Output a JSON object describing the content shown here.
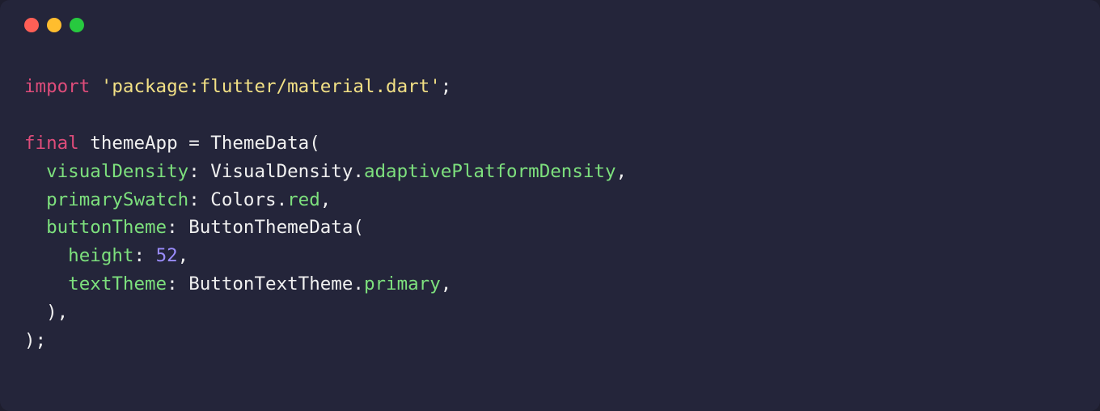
{
  "lights": {
    "red": "red",
    "yellow": "yellow",
    "green": "green"
  },
  "code": {
    "l1_import": "import",
    "l1_string": "'package:flutter/material.dart'",
    "l1_semi": ";",
    "l2_final": "final",
    "l2_name": " themeApp ",
    "l2_eq": "= ",
    "l2_call": "ThemeData(",
    "l3_param": "  visualDensity",
    "l3_colon": ": ",
    "l3_val1": "VisualDensity.",
    "l3_member": "adaptivePlatformDensity",
    "l3_comma": ",",
    "l4_param": "  primarySwatch",
    "l4_colon": ": ",
    "l4_val1": "Colors.",
    "l4_member": "red",
    "l4_comma": ",",
    "l5_param": "  buttonTheme",
    "l5_colon": ": ",
    "l5_call": "ButtonThemeData(",
    "l6_param": "    height",
    "l6_colon": ": ",
    "l6_num": "52",
    "l6_comma": ",",
    "l7_param": "    textTheme",
    "l7_colon": ": ",
    "l7_val1": "ButtonTextTheme.",
    "l7_member": "primary",
    "l7_comma": ",",
    "l8_close": "  ),",
    "l9_close": ");"
  }
}
